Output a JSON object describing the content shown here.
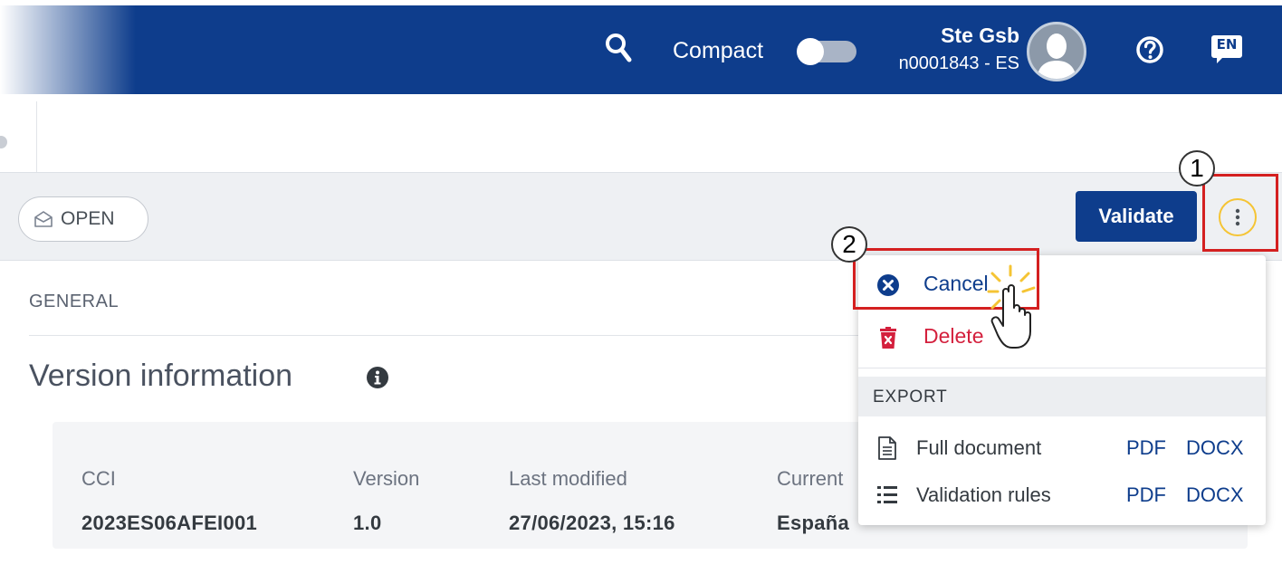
{
  "header": {
    "compact_label": "Compact",
    "compact_enabled": false,
    "user": {
      "name": "Ste Gsb",
      "id": "n0001843 - ES"
    },
    "language": "EN"
  },
  "actionbar": {
    "status": "OPEN",
    "validate_label": "Validate"
  },
  "content": {
    "section_label": "GENERAL",
    "title": "Version information",
    "fields": [
      {
        "label": "CCI",
        "value": "2023ES06AFEI001"
      },
      {
        "label": "Version",
        "value": "1.0"
      },
      {
        "label": "Last modified",
        "value": "27/06/2023, 15:16"
      },
      {
        "label": "Current",
        "value": "España"
      }
    ]
  },
  "menu": {
    "items": [
      {
        "label": "Cancel",
        "icon": "times-circle-icon",
        "color": "#0e3d8c"
      },
      {
        "label": "Delete",
        "icon": "trash-icon",
        "color": "#d4203d"
      }
    ],
    "export_header": "EXPORT",
    "exports": [
      {
        "label": "Full document",
        "icon": "document-icon",
        "pdf": "PDF",
        "docx": "DOCX"
      },
      {
        "label": "Validation rules",
        "icon": "list-icon",
        "pdf": "PDF",
        "docx": "DOCX"
      }
    ]
  },
  "annotations": {
    "step1": "1",
    "step2": "2"
  },
  "colors": {
    "primary": "#0e3d8c",
    "danger": "#d4203d",
    "highlight": "#d42020",
    "focus": "#f5c434"
  }
}
